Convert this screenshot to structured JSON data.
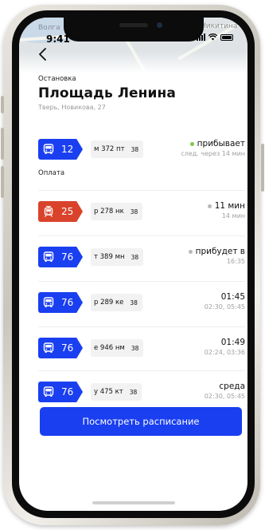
{
  "status_bar": {
    "time": "9:41"
  },
  "map": {
    "label_left": "Волга",
    "label_right": "Никитина"
  },
  "stop": {
    "section_label": "Остановка",
    "title": "Площадь Ленина",
    "address": "Тверь, Новикова, 27"
  },
  "colors": {
    "blue": "#1a3ff0",
    "red": "#d9432b",
    "green_dot": "#7cc84a",
    "gray_dot": "#b8b8b8"
  },
  "featured": {
    "route": "12",
    "type": "bus",
    "color": "blue",
    "plate": "м 372 пт",
    "region": "38",
    "eta_main": "прибывает",
    "eta_sub": "след. через 14 мин",
    "dot": "green"
  },
  "payment_label": "Оплата",
  "routes": [
    {
      "route": "25",
      "type": "tram",
      "color": "red",
      "plate": "р 278 нк",
      "region": "38",
      "eta_main": "11 мин",
      "eta_sub": "14 мин",
      "dot": "gray"
    },
    {
      "route": "76",
      "type": "bus",
      "color": "blue",
      "plate": "т 389 мн",
      "region": "38",
      "eta_main": "прибудет в",
      "eta_sub": "16:35",
      "dot": "gray"
    },
    {
      "route": "76",
      "type": "bus",
      "color": "blue",
      "plate": "р 289 ке",
      "region": "38",
      "eta_main": "01:45",
      "eta_sub": "02:30, 05:45",
      "dot": ""
    },
    {
      "route": "76",
      "type": "bus",
      "color": "blue",
      "plate": "е 946 нм",
      "region": "38",
      "eta_main": "01:49",
      "eta_sub": "02:24, 03:36",
      "dot": ""
    },
    {
      "route": "76",
      "type": "bus",
      "color": "blue",
      "plate": "у 475 кт",
      "region": "38",
      "eta_main": "среда",
      "eta_sub": "02:30, 05:45",
      "dot": ""
    }
  ],
  "schedule_button": "Посмотреть расписание",
  "icons": {
    "back": "chevron-left-icon",
    "bus": "bus-icon",
    "tram": "tram-icon"
  }
}
